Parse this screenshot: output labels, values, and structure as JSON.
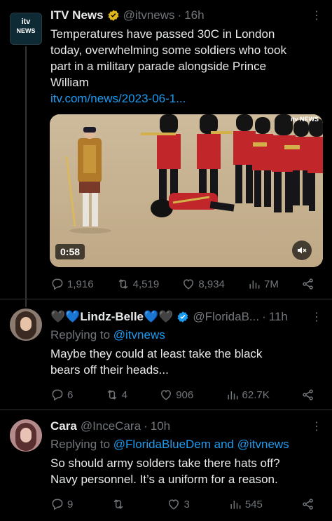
{
  "tweet1": {
    "logo_line1": "itv",
    "logo_line2": "NEWS",
    "display_name": "ITV News",
    "handle": "@itvnews",
    "sep": "·",
    "time": "16h",
    "text_line1": "Temperatures have passed 30C in London",
    "text_line2": "today, overwhelming some soldiers who took",
    "text_line3": "part in a military parade alongside Prince",
    "text_line4": "William",
    "link": "itv.com/news/2023-06-1...",
    "video_watermark": "itv NEWS",
    "video_duration": "0:58",
    "actions": {
      "replies": "1,916",
      "retweets": "4,519",
      "likes": "8,934",
      "views": "7M"
    }
  },
  "reply1": {
    "display_name": "🖤💙Lindz-Belle💙🖤",
    "handle": "@FloridaB...",
    "sep": "·",
    "time": "11h",
    "replying_prefix": "Replying to ",
    "replying_to": "@itvnews",
    "text_line1": "Maybe they could at least take the black",
    "text_line2": "bears off their heads...",
    "actions": {
      "replies": "6",
      "retweets": "4",
      "likes": "906",
      "views": "62.7K"
    }
  },
  "reply2": {
    "display_name": "Cara",
    "handle": "@InceCara",
    "sep": "·",
    "time": "10h",
    "replying_prefix": "Replying to ",
    "replying_to": "@FloridaBlueDem and @itvnews",
    "text_line1": "So should army solders take there hats off?",
    "text_line2": "Navy personnel. It’s a uniform for a reason.",
    "actions": {
      "replies": "9",
      "retweets": "",
      "likes": "3",
      "views": "545"
    }
  },
  "colors": {
    "accent": "#1d9bf0",
    "muted": "#71767b",
    "verified_gold": "#e2b719",
    "background": "#000000"
  }
}
